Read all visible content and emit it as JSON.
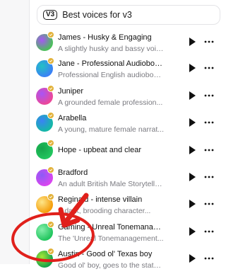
{
  "filter": {
    "badge": "V3",
    "label": "Best voices for v3"
  },
  "voices": [
    {
      "name": "James - Husky & Engaging",
      "description": "A slightly husky and bassy voic...",
      "colors": [
        "#4bbf5a",
        "#a855f7"
      ]
    },
    {
      "name": "Jane - Professional Audiobook...",
      "description": "Professional English audiobook...",
      "colors": [
        "#3b82f6",
        "#22c1c3"
      ]
    },
    {
      "name": "Juniper",
      "description": "A grounded female profession...",
      "colors": [
        "#ec4899",
        "#a855f7"
      ]
    },
    {
      "name": "Arabella",
      "description": "A young, mature female narrat...",
      "colors": [
        "#14b8a6",
        "#3b82f6"
      ]
    },
    {
      "name": "Hope - upbeat and clear",
      "description": "",
      "colors": [
        "#22c55e",
        "#16a34a"
      ]
    },
    {
      "name": "Bradford",
      "description": "An adult British Male Storytelle...",
      "colors": [
        "#d946ef",
        "#8b5cf6"
      ]
    },
    {
      "name": "Reginald - intense villain",
      "description": "A dark, brooding character...",
      "colors": [
        "#f59e0b",
        "#fde68a"
      ]
    },
    {
      "name": "Gaming - Unreal Tonemanage...",
      "description": "The 'Unreal Tonemanagement...",
      "colors": [
        "#22c55e",
        "#86efac"
      ]
    },
    {
      "name": "Austin - Good ol' Texas boy",
      "description": "Good ol' boy, goes to the state...",
      "colors": [
        "#16a34a",
        "#a3e635"
      ]
    }
  ],
  "colors": {
    "annotation_red": "#e0201b",
    "verified_gold": "#e2b23a"
  }
}
